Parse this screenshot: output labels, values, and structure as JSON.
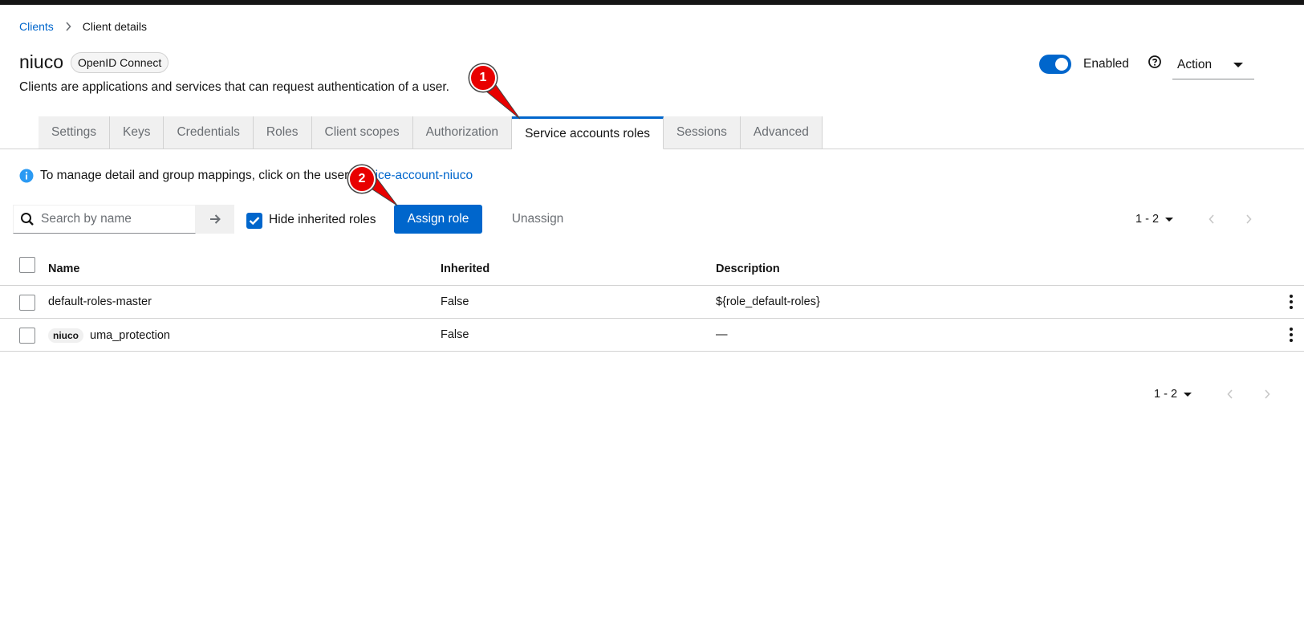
{
  "breadcrumb": {
    "root": "Clients",
    "current": "Client details"
  },
  "client": {
    "name": "niuco",
    "protocol": "OpenID Connect",
    "description": "Clients are applications and services that can request authentication of a user."
  },
  "header": {
    "enabled_label": "Enabled",
    "enabled": true,
    "action_label": "Action"
  },
  "tabs": [
    {
      "label": "Settings",
      "active": false
    },
    {
      "label": "Keys",
      "active": false
    },
    {
      "label": "Credentials",
      "active": false
    },
    {
      "label": "Roles",
      "active": false
    },
    {
      "label": "Client scopes",
      "active": false
    },
    {
      "label": "Authorization",
      "active": false
    },
    {
      "label": "Service accounts roles",
      "active": true
    },
    {
      "label": "Sessions",
      "active": false
    },
    {
      "label": "Advanced",
      "active": false
    }
  ],
  "info": {
    "text": "To manage detail and group mappings, click on the user",
    "link": "service-account-niuco"
  },
  "toolbar": {
    "search_placeholder": "Search by name",
    "hide_inherited_label": "Hide inherited roles",
    "hide_inherited_checked": true,
    "assign_label": "Assign role",
    "unassign_label": "Unassign"
  },
  "pagination": {
    "range": "1 - 2"
  },
  "table": {
    "headers": {
      "name": "Name",
      "inherited": "Inherited",
      "description": "Description"
    },
    "rows": [
      {
        "client_label": "",
        "name": "default-roles-master",
        "inherited": "False",
        "description": "${role_default-roles}"
      },
      {
        "client_label": "niuco",
        "name": "uma_protection",
        "inherited": "False",
        "description": "—"
      }
    ]
  },
  "annotations": [
    {
      "label": "1"
    },
    {
      "label": "2"
    }
  ],
  "colors": {
    "accent": "#0066cc",
    "annotation": "#e80000"
  },
  "icons": {
    "breadcrumb_separator": "chevron-right-icon",
    "help": "question-circle-icon",
    "info": "info-circle-icon",
    "search": "search-icon",
    "search_submit": "arrow-right-icon",
    "kebab": "kebab-icon"
  }
}
